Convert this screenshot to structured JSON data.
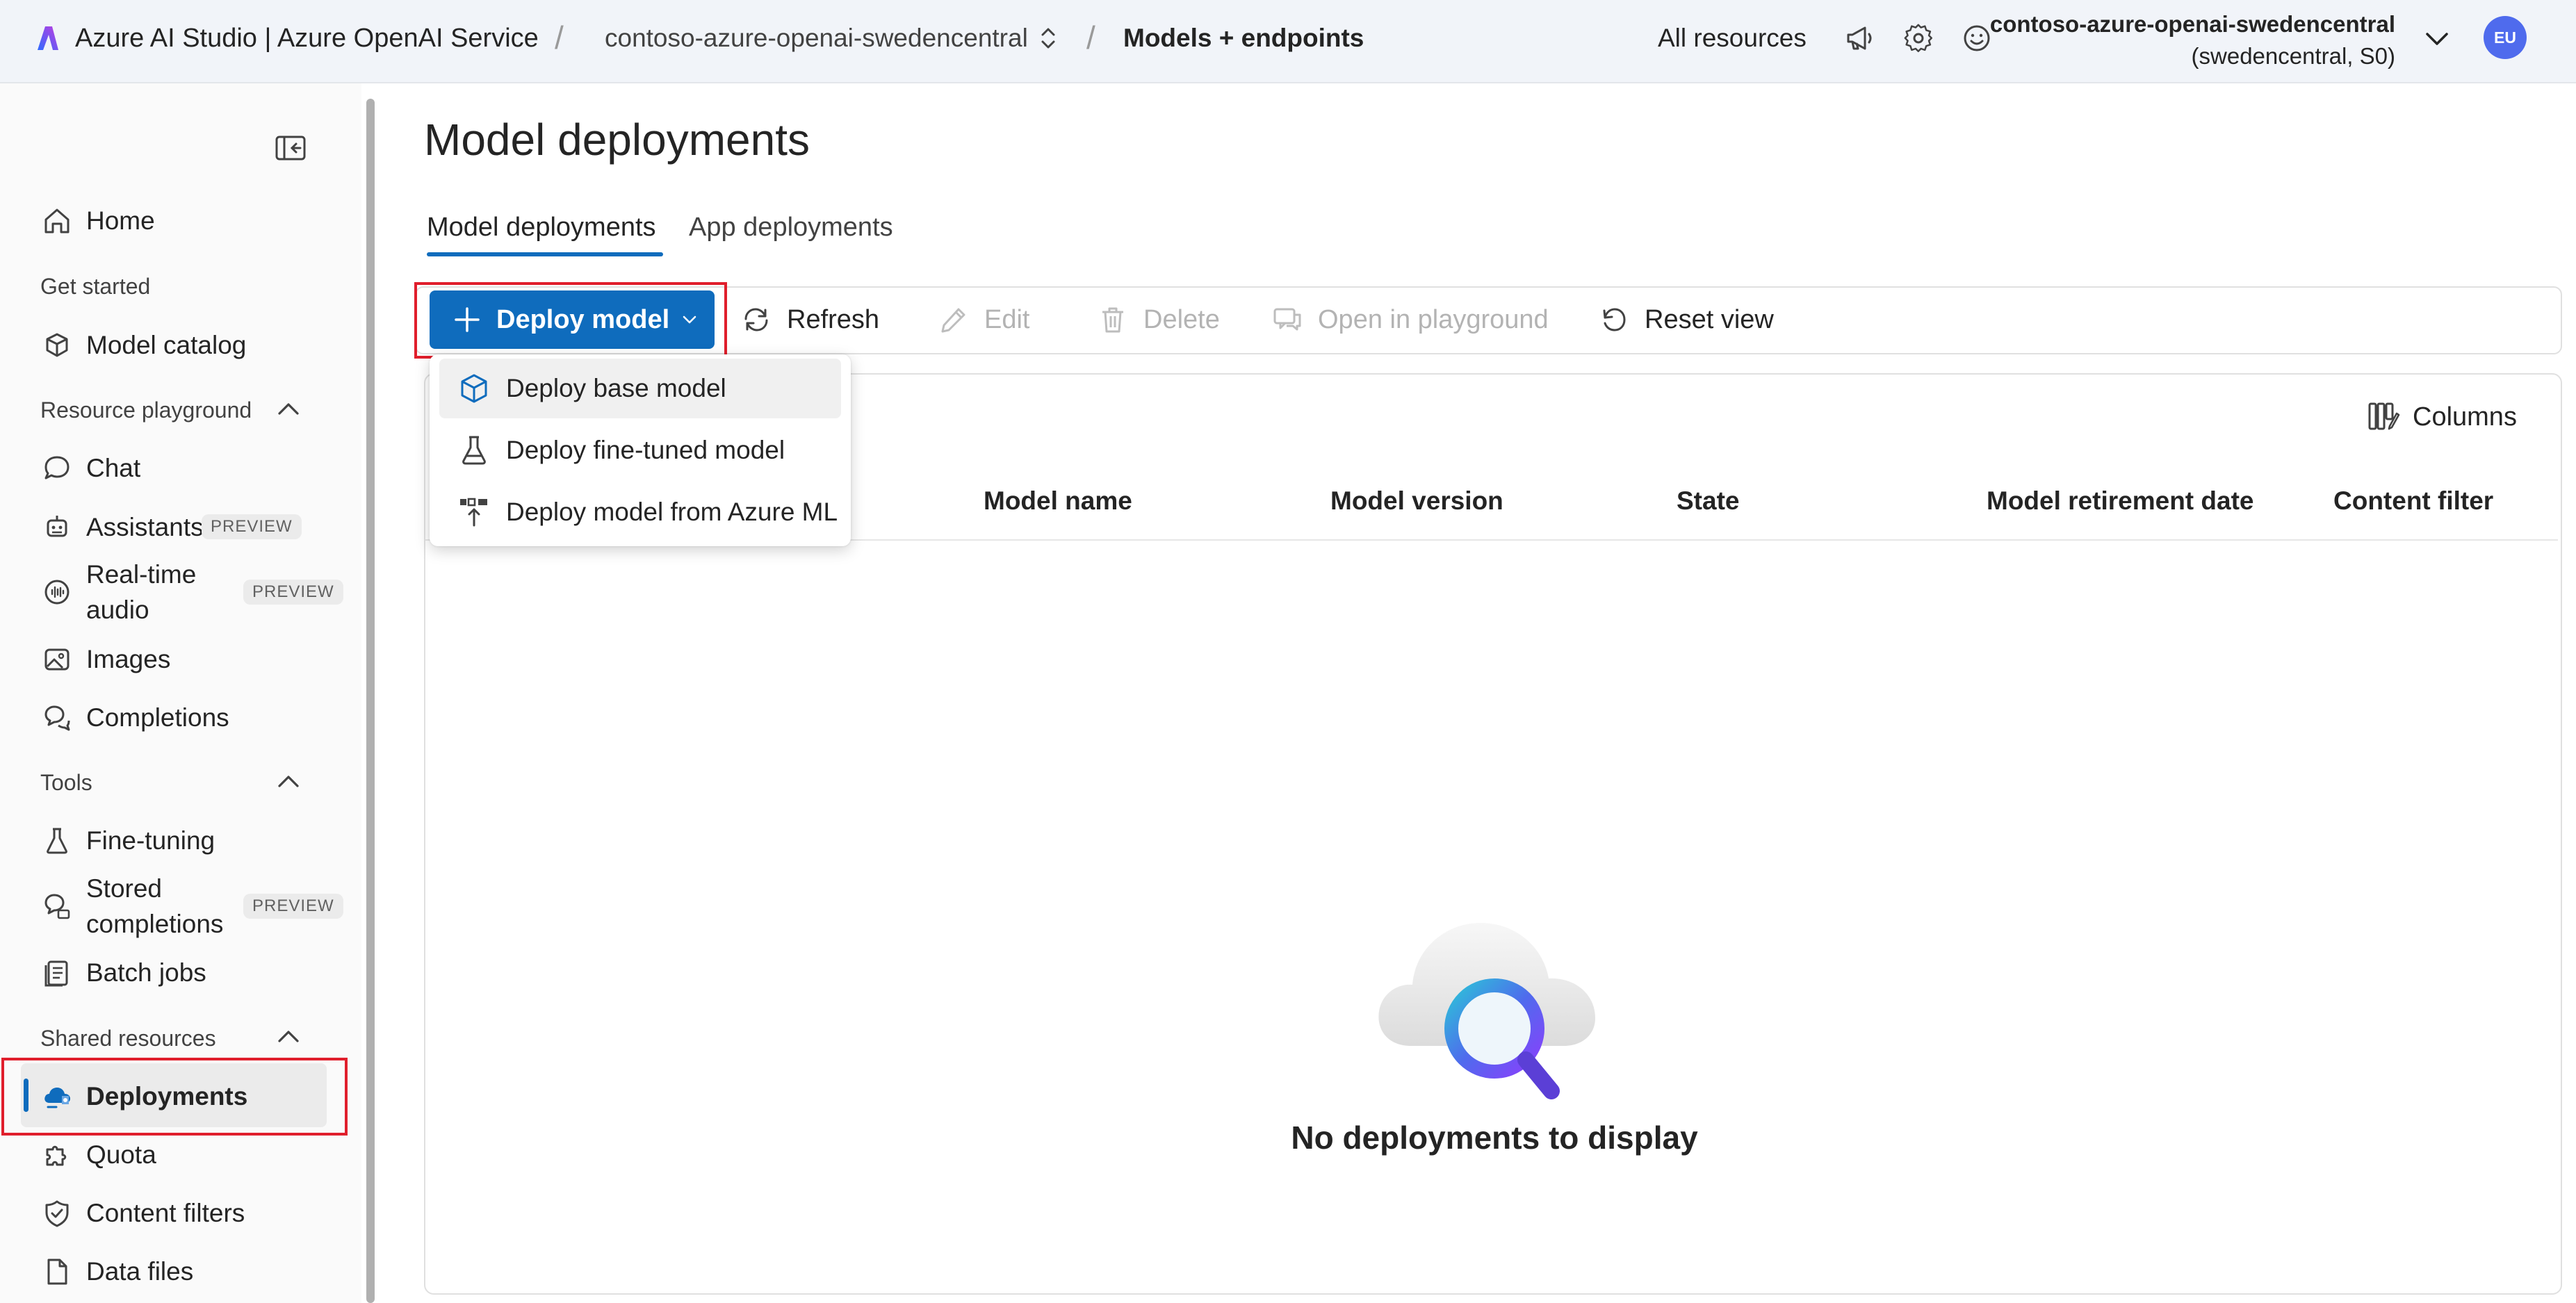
{
  "header": {
    "brand": "Azure AI Studio | Azure OpenAI Service",
    "resource_crumb": "contoso-azure-openai-swedencentral",
    "page_crumb": "Models + endpoints",
    "all_resources": "All resources",
    "account_name": "contoso-azure-openai-swedencentral",
    "account_sub": "(swedencentral, S0)",
    "avatar": "EU"
  },
  "sidebar": {
    "home": "Home",
    "get_started": "Get started",
    "model_catalog": "Model catalog",
    "resource_playground": "Resource playground",
    "chat": "Chat",
    "assistants": "Assistants",
    "realtime_line1": "Real-time",
    "realtime_line2": "audio",
    "images": "Images",
    "completions": "Completions",
    "tools": "Tools",
    "fine_tuning": "Fine-tuning",
    "stored_line1": "Stored",
    "stored_line2": "completions",
    "batch_jobs": "Batch jobs",
    "shared_resources": "Shared resources",
    "deployments": "Deployments",
    "quota": "Quota",
    "content_filters": "Content filters",
    "data_files": "Data files",
    "preview_badge": "PREVIEW"
  },
  "main": {
    "title": "Model deployments",
    "tabs": [
      "Model deployments",
      "App deployments"
    ],
    "toolbar": {
      "deploy": "Deploy model",
      "refresh": "Refresh",
      "edit": "Edit",
      "delete": "Delete",
      "open_playground": "Open in playground",
      "reset_view": "Reset view"
    },
    "columns_button": "Columns",
    "table_headers": [
      "Model name",
      "Model version",
      "State",
      "Model retirement date",
      "Content filter"
    ],
    "empty_message": "No deployments to display"
  },
  "deploy_menu": {
    "items": [
      "Deploy base model",
      "Deploy fine-tuned model",
      "Deploy model from Azure ML"
    ]
  },
  "colors": {
    "accent": "#0f6cbd",
    "highlight_box": "#e01e2c",
    "avatar": "#4f6bed"
  }
}
